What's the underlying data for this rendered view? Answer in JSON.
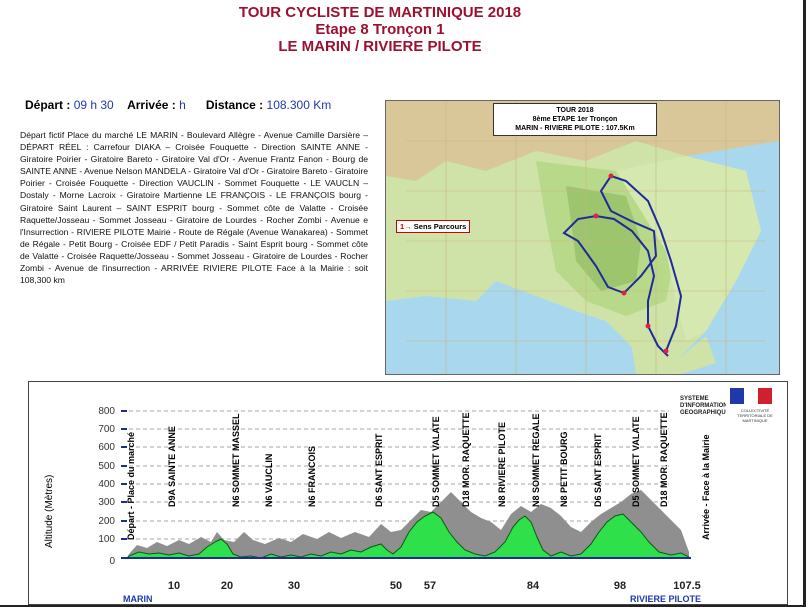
{
  "titles": {
    "line1": "TOUR CYCLISTE DE MARTINIQUE 2018",
    "line2": "Etape 8 Tronçon 1",
    "line3": "LE MARIN / RIVIERE PILOTE"
  },
  "info": {
    "depart_label": "Départ :",
    "depart_value": "09 h 30",
    "arrivee_label": "Arrivée :",
    "arrivee_value": "h",
    "distance_label": "Distance :",
    "distance_value": "108.300 Km"
  },
  "description": "Départ fictif Place du marché LE MARIN - Boulevard Allègre - Avenue Camille Darsière – DÉPART RÉEL : Carrefour DIAKA – Croisée Fouquette - Direction SAINTE ANNE - Giratoire Poirier - Giratoire Bareto - Giratoire Val d'Or - Avenue Frantz Fanon - Bourg de SAINTE ANNE - Avenue Nelson MANDELA - Giratoire Val d'Or - Giratoire Bareto - Giratoire Poirier - Croisée Fouquette - Direction VAUCLIN - Sommet Fouquette - LE VAUCLN – Dostaly - Morne Lacroix - Giratoire Martienne LE FRANÇOIS - LE FRANÇOIS bourg - Giratoire Saint Laurent – SAINT ESPRIT bourg - Sommet côte de Valatte - Croisée Raquette/Josseau - Sommet Josseau - Giratoire de Lourdes - Rocher Zombi - Avenue e l'Insurrection - RIVIERE PILOTE Mairie - Route de Régale (Avenue Wanakarea) - Sommet de Régale - Petit Bourg - Croisée EDF / Petit Paradis - Saint Esprit bourg - Sommet côte de Valatte - Croisée Raquette/Josseau - Sommet Josseau - Giratoire de Lourdes - Rocher Zombi - Avenue de l'insurrection - ARRIVÉE RIVIERE PILOTE Face à la Mairie : soit 108,300 km",
  "map": {
    "label_line1": "TOUR 2018",
    "label_line2": "8ème ETAPE 1er Tronçon",
    "label_line3": "MARIN - RIVIERE PILOTE : 107.5Km",
    "sens_arrow": "1→",
    "sens_label": "Sens Parcours"
  },
  "profile": {
    "ylabel": "Altitude (Mètres)",
    "yticks": [
      "800",
      "700",
      "600",
      "500",
      "400",
      "300",
      "200",
      "100",
      "0"
    ],
    "places": [
      "Départ - Place du marché",
      "D9A SAINTE ANNE",
      "N6 SOMMET MASSEL",
      "N6 VAUCLIN",
      "N6 FRANCOIS",
      "D6 SANT ESPRIT",
      "D5 SOMMET VALATE",
      "D18 MOR. RAQUETTE",
      "N8 RIVIERE PILOTE",
      "N8 SOMMET REGALE",
      "N8 PETIT BOURG",
      "D6 SANT ESPRIT",
      "D5 SOMMET VALATE",
      "D18 MOR. RAQUETTE",
      "Arrivée - Face à la Mairie"
    ],
    "kms": [
      "10",
      "20",
      "30",
      "50",
      "57",
      "84",
      "98",
      "107.5"
    ],
    "start_town": "MARIN",
    "end_town": "RIVIERE PILOTE",
    "ign_text": "SYSTEME D'INFORMATION GEOGRAPHIQUE",
    "logo_text": "COLLECTIVITÉ TERRITORIALE DE MARTINIQUE",
    "course_color": "#2ee04a",
    "terrain_color": "#8f8f8f"
  }
}
